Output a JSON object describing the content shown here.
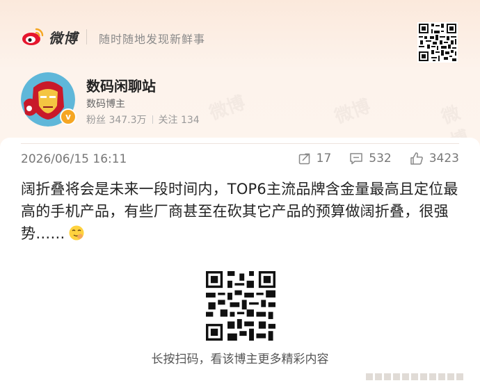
{
  "header": {
    "brand": "微博",
    "slogan": "随时随地发现新鲜事"
  },
  "profile": {
    "name": "数码闲聊站",
    "role": "数码博主",
    "fans": "粉丝 347.3万",
    "following": "关注 134",
    "badge": "v"
  },
  "post": {
    "date": "2026/06/15 16:11",
    "reposts": "17",
    "comments": "532",
    "likes": "3423",
    "text": "阔折叠将会是未来一段时间内，TOP6主流品牌含金量最高且定位最高的手机产品，有些厂商甚至在砍其它产品的预算做阔折叠，很强势……"
  },
  "footer": {
    "qr_hint": "长按扫码，看该博主更多精彩内容"
  },
  "icons": [
    "weibo-logo-icon",
    "repost-icon",
    "comment-icon",
    "like-icon",
    "emoji-icon",
    "qr-code-icon"
  ],
  "colors": {
    "accent": "#e6162d",
    "badge": "#f5a623",
    "background": "#fdf3ec"
  }
}
